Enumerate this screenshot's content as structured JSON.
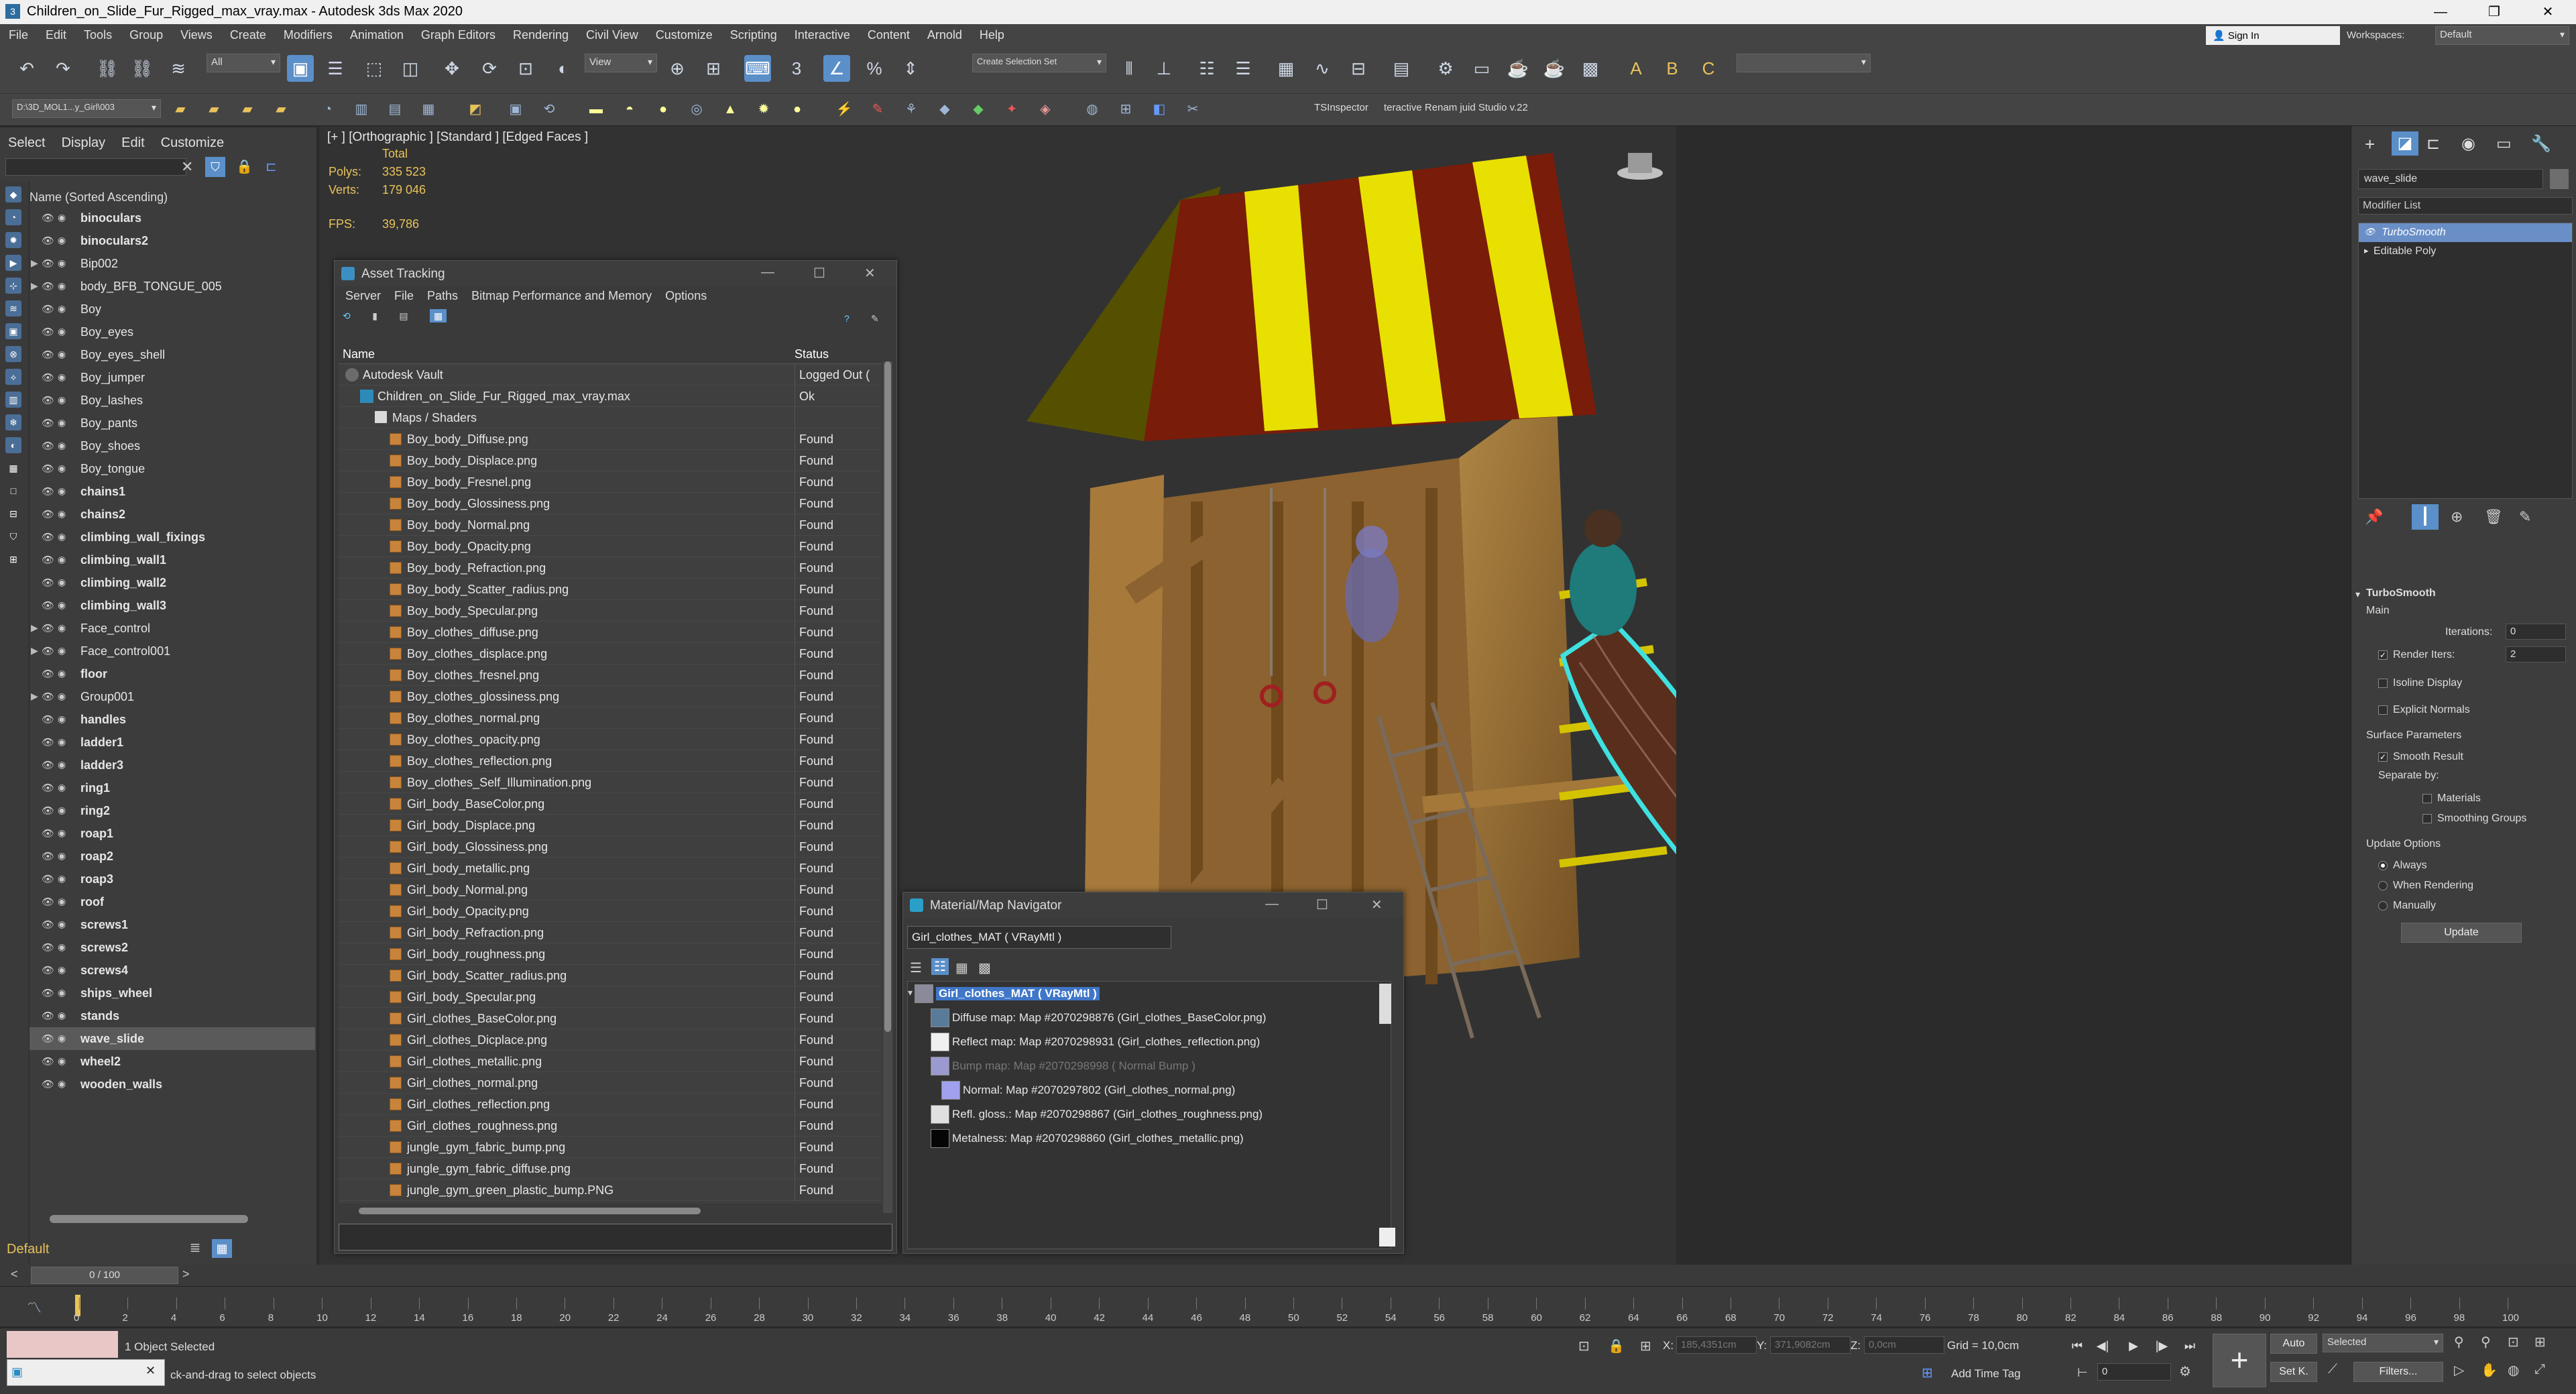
{
  "window": {
    "title": "Children_on_Slide_Fur_Rigged_max_vray.max - Autodesk 3ds Max 2020",
    "minimize": "—",
    "maximize": "❐",
    "close": "✕"
  },
  "menubar": [
    "File",
    "Edit",
    "Tools",
    "Group",
    "Views",
    "Create",
    "Modifiers",
    "Animation",
    "Graph Editors",
    "Rendering",
    "Civil View",
    "Customize",
    "Scripting",
    "Interactive",
    "Content",
    "Arnold",
    "Help"
  ],
  "account": {
    "sign_in": "Sign In",
    "workspaces_label": "Workspaces:",
    "workspaces_value": "Default"
  },
  "toolbar": {
    "selection_filter": "All",
    "reference_coord": "View",
    "selection_set": "Create Selection Set",
    "path": "D:\\3D_MOL1...y_Girl\\003",
    "tsinspector": "TSInspector",
    "studio": "teractive Renam juid Studio v.22"
  },
  "scene_explorer": {
    "tabs": [
      "Select",
      "Display",
      "Edit",
      "Customize"
    ],
    "header": "Name (Sorted Ascending)",
    "layer": "Default",
    "items": [
      {
        "name": "binoculars",
        "bold": true
      },
      {
        "name": "binoculars2",
        "bold": true
      },
      {
        "name": "Bip002",
        "bold": false,
        "expand": true
      },
      {
        "name": "body_BFB_TONGUE_005",
        "bold": false,
        "expand": true
      },
      {
        "name": "Boy",
        "bold": false
      },
      {
        "name": "Boy_eyes",
        "bold": false
      },
      {
        "name": "Boy_eyes_shell",
        "bold": false
      },
      {
        "name": "Boy_jumper",
        "bold": false
      },
      {
        "name": "Boy_lashes",
        "bold": false
      },
      {
        "name": "Boy_pants",
        "bold": false
      },
      {
        "name": "Boy_shoes",
        "bold": false
      },
      {
        "name": "Boy_tongue",
        "bold": false
      },
      {
        "name": "chains1",
        "bold": true
      },
      {
        "name": "chains2",
        "bold": true
      },
      {
        "name": "climbing_wall_fixings",
        "bold": true
      },
      {
        "name": "climbing_wall1",
        "bold": true
      },
      {
        "name": "climbing_wall2",
        "bold": true
      },
      {
        "name": "climbing_wall3",
        "bold": true
      },
      {
        "name": "Face_control",
        "bold": false,
        "expand": true
      },
      {
        "name": "Face_control001",
        "bold": false,
        "expand": true
      },
      {
        "name": "floor",
        "bold": true
      },
      {
        "name": "Group001",
        "bold": false,
        "expand": true
      },
      {
        "name": "handles",
        "bold": true
      },
      {
        "name": "ladder1",
        "bold": true
      },
      {
        "name": "ladder3",
        "bold": true
      },
      {
        "name": "ring1",
        "bold": true
      },
      {
        "name": "ring2",
        "bold": true
      },
      {
        "name": "roap1",
        "bold": true
      },
      {
        "name": "roap2",
        "bold": true
      },
      {
        "name": "roap3",
        "bold": true
      },
      {
        "name": "roof",
        "bold": true
      },
      {
        "name": "screws1",
        "bold": true
      },
      {
        "name": "screws2",
        "bold": true
      },
      {
        "name": "screws4",
        "bold": true
      },
      {
        "name": "ships_wheel",
        "bold": true
      },
      {
        "name": "stands",
        "bold": true
      },
      {
        "name": "wave_slide",
        "bold": true,
        "selected": true
      },
      {
        "name": "wheel2",
        "bold": true
      },
      {
        "name": "wooden_walls",
        "bold": true
      }
    ]
  },
  "viewport": {
    "label": "[+ ] [Orthographic ] [Standard ] [Edged Faces ]",
    "stats": {
      "total": "Total",
      "polys_label": "Polys:",
      "polys": "335 523",
      "verts_label": "Verts:",
      "verts": "179 046",
      "fps_label": "FPS:",
      "fps": "39,786"
    }
  },
  "asset_tracking": {
    "title": "Asset Tracking",
    "menu": [
      "Server",
      "File",
      "Paths",
      "Bitmap Performance and Memory",
      "Options"
    ],
    "col_name": "Name",
    "col_status": "Status",
    "rows": [
      {
        "name": "Autodesk Vault",
        "status": "Logged Out (",
        "indent": 0,
        "kind": "vault"
      },
      {
        "name": "Children_on_Slide_Fur_Rigged_max_vray.max",
        "status": "Ok",
        "indent": 1,
        "kind": "scene"
      },
      {
        "name": "Maps / Shaders",
        "status": "",
        "indent": 2,
        "kind": "maps"
      },
      {
        "name": "Boy_body_Diffuse.png",
        "status": "Found",
        "indent": 3,
        "kind": "file"
      },
      {
        "name": "Boy_body_Displace.png",
        "status": "Found",
        "indent": 3,
        "kind": "file"
      },
      {
        "name": "Boy_body_Fresnel.png",
        "status": "Found",
        "indent": 3,
        "kind": "file"
      },
      {
        "name": "Boy_body_Glossiness.png",
        "status": "Found",
        "indent": 3,
        "kind": "file"
      },
      {
        "name": "Boy_body_Normal.png",
        "status": "Found",
        "indent": 3,
        "kind": "file"
      },
      {
        "name": "Boy_body_Opacity.png",
        "status": "Found",
        "indent": 3,
        "kind": "file"
      },
      {
        "name": "Boy_body_Refraction.png",
        "status": "Found",
        "indent": 3,
        "kind": "file"
      },
      {
        "name": "Boy_body_Scatter_radius.png",
        "status": "Found",
        "indent": 3,
        "kind": "file"
      },
      {
        "name": "Boy_body_Specular.png",
        "status": "Found",
        "indent": 3,
        "kind": "file"
      },
      {
        "name": "Boy_clothes_diffuse.png",
        "status": "Found",
        "indent": 3,
        "kind": "file"
      },
      {
        "name": "Boy_clothes_displace.png",
        "status": "Found",
        "indent": 3,
        "kind": "file"
      },
      {
        "name": "Boy_clothes_fresnel.png",
        "status": "Found",
        "indent": 3,
        "kind": "file"
      },
      {
        "name": "Boy_clothes_glossiness.png",
        "status": "Found",
        "indent": 3,
        "kind": "file"
      },
      {
        "name": "Boy_clothes_normal.png",
        "status": "Found",
        "indent": 3,
        "kind": "file"
      },
      {
        "name": "Boy_clothes_opacity.png",
        "status": "Found",
        "indent": 3,
        "kind": "file"
      },
      {
        "name": "Boy_clothes_reflection.png",
        "status": "Found",
        "indent": 3,
        "kind": "file"
      },
      {
        "name": "Boy_clothes_Self_Illumination.png",
        "status": "Found",
        "indent": 3,
        "kind": "file"
      },
      {
        "name": "Girl_body_BaseColor.png",
        "status": "Found",
        "indent": 3,
        "kind": "file"
      },
      {
        "name": "Girl_body_Displace.png",
        "status": "Found",
        "indent": 3,
        "kind": "file"
      },
      {
        "name": "Girl_body_Glossiness.png",
        "status": "Found",
        "indent": 3,
        "kind": "file"
      },
      {
        "name": "Girl_body_metallic.png",
        "status": "Found",
        "indent": 3,
        "kind": "file"
      },
      {
        "name": "Girl_body_Normal.png",
        "status": "Found",
        "indent": 3,
        "kind": "file"
      },
      {
        "name": "Girl_body_Opacity.png",
        "status": "Found",
        "indent": 3,
        "kind": "file"
      },
      {
        "name": "Girl_body_Refraction.png",
        "status": "Found",
        "indent": 3,
        "kind": "file"
      },
      {
        "name": "Girl_body_roughness.png",
        "status": "Found",
        "indent": 3,
        "kind": "file"
      },
      {
        "name": "Girl_body_Scatter_radius.png",
        "status": "Found",
        "indent": 3,
        "kind": "file"
      },
      {
        "name": "Girl_body_Specular.png",
        "status": "Found",
        "indent": 3,
        "kind": "file"
      },
      {
        "name": "Girl_clothes_BaseColor.png",
        "status": "Found",
        "indent": 3,
        "kind": "file"
      },
      {
        "name": "Girl_clothes_Dicplace.png",
        "status": "Found",
        "indent": 3,
        "kind": "file"
      },
      {
        "name": "Girl_clothes_metallic.png",
        "status": "Found",
        "indent": 3,
        "kind": "file"
      },
      {
        "name": "Girl_clothes_normal.png",
        "status": "Found",
        "indent": 3,
        "kind": "file"
      },
      {
        "name": "Girl_clothes_reflection.png",
        "status": "Found",
        "indent": 3,
        "kind": "file"
      },
      {
        "name": "Girl_clothes_roughness.png",
        "status": "Found",
        "indent": 3,
        "kind": "file"
      },
      {
        "name": "jungle_gym_fabric_bump.png",
        "status": "Found",
        "indent": 3,
        "kind": "file"
      },
      {
        "name": "jungle_gym_fabric_diffuse.png",
        "status": "Found",
        "indent": 3,
        "kind": "file"
      },
      {
        "name": "jungle_gym_green_plastic_bump.PNG",
        "status": "Found",
        "indent": 3,
        "kind": "file"
      }
    ]
  },
  "material_navigator": {
    "title": "Material/Map Navigator",
    "field": "Girl_clothes_MAT  ( VRayMtl )",
    "rows": [
      {
        "text": "Girl_clothes_MAT  ( VRayMtl )",
        "selected": true,
        "dim": false,
        "swatch": "#8a8a9a"
      },
      {
        "text": "Diffuse map: Map #2070298876 (Girl_clothes_BaseColor.png)",
        "selected": false,
        "dim": false,
        "swatch": "#5a7a9a"
      },
      {
        "text": "Reflect map: Map #2070298931 (Girl_clothes_reflection.png)",
        "selected": false,
        "dim": false,
        "swatch": "#f0f0f0"
      },
      {
        "text": "Bump map: Map #2070298998  ( Normal Bump )",
        "selected": false,
        "dim": true,
        "swatch": "#9a9ad0"
      },
      {
        "text": "Normal: Map #2070297802 (Girl_clothes_normal.png)",
        "selected": false,
        "dim": false,
        "swatch": "#a0a0ee"
      },
      {
        "text": "Refl. gloss.: Map #2070298867 (Girl_clothes_roughness.png)",
        "selected": false,
        "dim": false,
        "swatch": "#e0e0e0"
      },
      {
        "text": "Metalness: Map #2070298860 (Girl_clothes_metallic.png)",
        "selected": false,
        "dim": false,
        "swatch": "#050505"
      }
    ]
  },
  "command_panel": {
    "object_name": "wave_slide",
    "modifier_list": "Modifier List",
    "stack": [
      "TurboSmooth",
      "Editable Poly"
    ],
    "turbosmooth": {
      "title": "TurboSmooth",
      "main": "Main",
      "iterations_label": "Iterations:",
      "iterations": "0",
      "render_iters_label": "Render Iters:",
      "render_iters": "2",
      "isoline": "Isoline Display",
      "explicit": "Explicit Normals",
      "surface": "Surface Parameters",
      "smooth_result": "Smooth Result",
      "separate_by": "Separate by:",
      "materials": "Materials",
      "smoothing_groups": "Smoothing Groups",
      "update_options": "Update Options",
      "always": "Always",
      "when_rendering": "When Rendering",
      "manually": "Manually",
      "update": "Update"
    }
  },
  "timeline": {
    "frame": "0 / 100",
    "ticks": [
      "0",
      "2",
      "4",
      "6",
      "8",
      "10",
      "12",
      "14",
      "16",
      "18",
      "20",
      "22",
      "24",
      "26",
      "28",
      "30",
      "32",
      "34",
      "36",
      "38",
      "40",
      "42",
      "44",
      "46",
      "48",
      "50",
      "52",
      "54",
      "56",
      "58",
      "60",
      "62",
      "64",
      "66",
      "68",
      "70",
      "72",
      "74",
      "76",
      "78",
      "80",
      "82",
      "84",
      "86",
      "88",
      "90",
      "92",
      "94",
      "96",
      "98",
      "100"
    ]
  },
  "status": {
    "selected": "1 Object Selected",
    "prompt": "ck-and-drag to select objects",
    "x_label": "X:",
    "x": "185,4351cm",
    "y_label": "Y:",
    "y": "371,9082cm",
    "z_label": "Z:",
    "z": "0,0cm",
    "grid": "Grid = 10,0cm",
    "add_time_tag": "Add Time Tag",
    "auto": "Auto",
    "selected_dd": "Selected",
    "setk": "Set K.",
    "filters": "Filters...",
    "frame_field": "0"
  }
}
